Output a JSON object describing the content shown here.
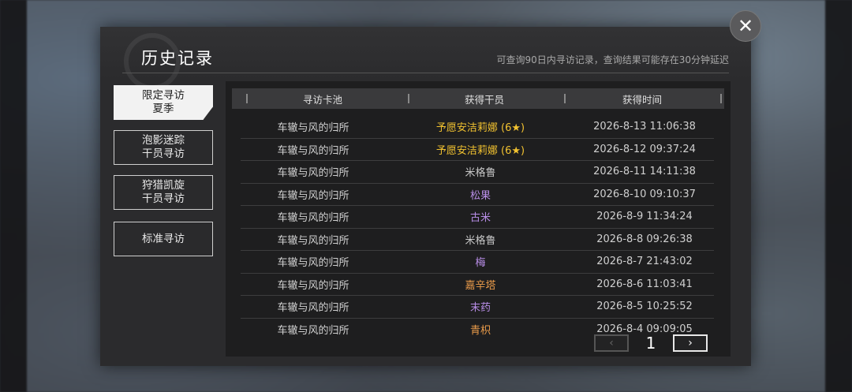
{
  "window": {
    "title": "历史记录",
    "notice": "可查询90日内寻访记录，查询结果可能存在30分钟延迟",
    "close_icon": "✕"
  },
  "tabs": [
    {
      "line1": "限定寻访",
      "line2": "夏季",
      "active": true
    },
    {
      "line1": "泡影迷踪",
      "line2": "干员寻访",
      "active": false
    },
    {
      "line1": "狩猎凯旋",
      "line2": "干员寻访",
      "active": false
    },
    {
      "line1": "标准寻访",
      "line2": "",
      "active": false
    }
  ],
  "table": {
    "headers": [
      "寻访卡池",
      "获得干员",
      "获得时间"
    ],
    "rows": [
      {
        "pool": "车辙与风的归所",
        "operator": "予愿安洁莉娜 (6★)",
        "time": "2026-8-13 11:06:38",
        "color": "#f2c230"
      },
      {
        "pool": "车辙与风的归所",
        "operator": "予愿安洁莉娜 (6★)",
        "time": "2026-8-12 09:37:24",
        "color": "#f2c230"
      },
      {
        "pool": "车辙与风的归所",
        "operator": "米格鲁",
        "time": "2026-8-11 14:11:38",
        "color": "#c8c8c8"
      },
      {
        "pool": "车辙与风的归所",
        "operator": "松果",
        "time": "2026-8-10 09:10:37",
        "color": "#b98ee8"
      },
      {
        "pool": "车辙与风的归所",
        "operator": "古米",
        "time": "2026-8-9 11:34:24",
        "color": "#b98ee8"
      },
      {
        "pool": "车辙与风的归所",
        "operator": "米格鲁",
        "time": "2026-8-8 09:26:38",
        "color": "#c8c8c8"
      },
      {
        "pool": "车辙与风的归所",
        "operator": "梅",
        "time": "2026-8-7 21:43:02",
        "color": "#b98ee8"
      },
      {
        "pool": "车辙与风的归所",
        "operator": "嘉辛塔",
        "time": "2026-8-6 11:03:41",
        "color": "#e89a4a"
      },
      {
        "pool": "车辙与风的归所",
        "operator": "末药",
        "time": "2026-8-5 10:25:52",
        "color": "#b98ee8"
      },
      {
        "pool": "车辙与风的归所",
        "operator": "青枳",
        "time": "2026-8-4 09:09:05",
        "color": "#e89a4a"
      }
    ]
  },
  "pager": {
    "page": "1",
    "prev_icon": "‹",
    "next_icon": "›"
  }
}
